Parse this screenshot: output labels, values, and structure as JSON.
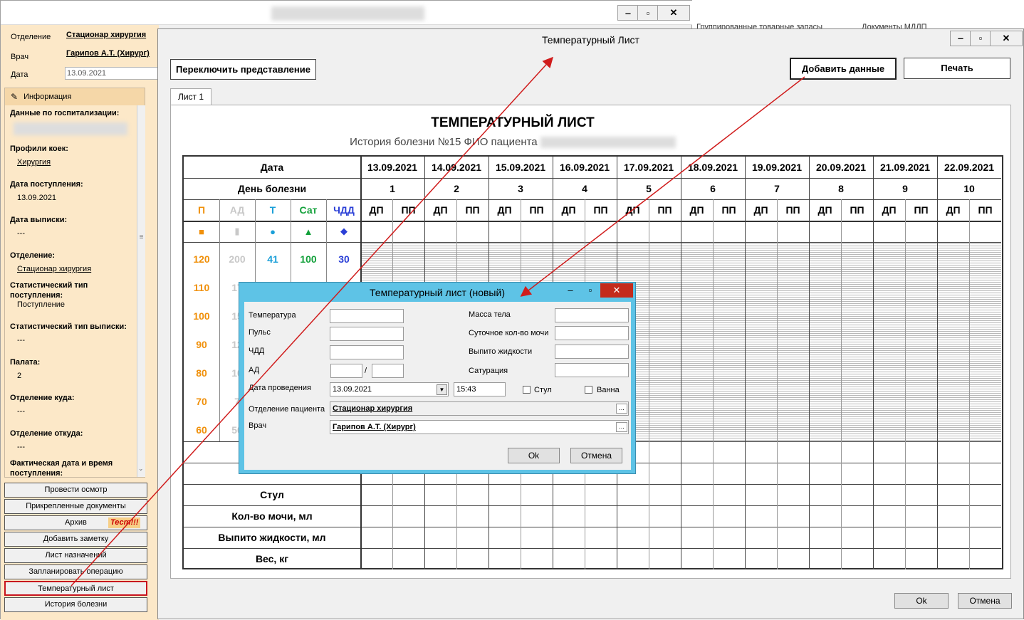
{
  "back": {
    "fields": {
      "dept_label": "Отделение",
      "dept_value": "Стационар хирургия",
      "doctor_label": "Врач",
      "doctor_value": "Гарипов А.Т. (Хирург)",
      "date_label": "Дата",
      "date_value": "13.09.2021"
    },
    "info": {
      "header": "Информация",
      "items": [
        {
          "label": "Данные по госпитализации:",
          "value": ""
        },
        {
          "label": "Профили коек:",
          "value": "Хирургия"
        },
        {
          "label": "Дата поступления:",
          "value": "13.09.2021"
        },
        {
          "label": "Дата выписки:",
          "value": "---"
        },
        {
          "label": "Отделение:",
          "value": "Стационар хирургия"
        },
        {
          "label": "Статистический тип поступления:",
          "value": "Поступление"
        },
        {
          "label": "Статистический тип выписки:",
          "value": "---"
        },
        {
          "label": "Палата:",
          "value": "2"
        },
        {
          "label": "Отделение куда:",
          "value": "---"
        },
        {
          "label": "Отделение откуда:",
          "value": "---"
        },
        {
          "label": "Фактическая дата и время поступления:",
          "value": ""
        }
      ]
    },
    "buttons": [
      "Провести осмотр",
      "Прикрепленные документы",
      "Архив",
      "Добавить заметку",
      "Лист назначений",
      "Запланировать операцию",
      "Температурный лист",
      "История болезни"
    ],
    "archive_badge": "Тест!!!",
    "bg_strip": {
      "item1": "Группированные товарные запасы",
      "item2": "Документы МДЛП"
    }
  },
  "main": {
    "title": "Температурный Лист",
    "switch_btn": "Переключить представление",
    "add_btn": "Добавить данные",
    "print_btn": "Печать",
    "tab": "Лист 1",
    "sheet_title": "ТЕМПЕРАТУРНЫЙ ЛИСТ",
    "sheet_subtitle": "История болезни №15 ФИО пациента",
    "grid": {
      "date_label": "Дата",
      "day_label": "День болезни",
      "dates": [
        "13.09.2021",
        "14.09.2021",
        "15.09.2021",
        "16.09.2021",
        "17.09.2021",
        "18.09.2021",
        "19.09.2021",
        "20.09.2021",
        "21.09.2021",
        "22.09.2021"
      ],
      "days": [
        "1",
        "2",
        "3",
        "4",
        "5",
        "6",
        "7",
        "8",
        "9",
        "10"
      ],
      "half_labels": [
        "ДП",
        "ПП"
      ],
      "params": [
        {
          "label": "П",
          "color": "#f0900a"
        },
        {
          "label": "АД",
          "color": "#c8c8c8"
        },
        {
          "label": "Т",
          "color": "#1a9fd8"
        },
        {
          "label": "Сат",
          "color": "#12a03a"
        },
        {
          "label": "ЧДД",
          "color": "#2a3fd6"
        }
      ],
      "scale": {
        "p": [
          "120",
          "110",
          "100",
          "90",
          "80",
          "70",
          "60"
        ],
        "ad": [
          "200",
          "17",
          "15",
          "12",
          "10",
          "7",
          "50"
        ],
        "t": [
          "41"
        ],
        "sat": [
          "100"
        ],
        "rr": [
          "30"
        ]
      },
      "bottom_rows": [
        "Стул",
        "Кол-во мочи, мл",
        "Выпито жидкости, мл",
        "Вес, кг"
      ]
    },
    "ok": "Ok",
    "cancel": "Отмена"
  },
  "dialog": {
    "title": "Температурный лист (новый)",
    "temperature": "Температура",
    "pulse": "Пульс",
    "rr": "ЧДД",
    "bp": "АД",
    "bp_sep": "/",
    "weight": "Масса тела",
    "urine": "Суточное кол-во мочи",
    "drunk": "Выпито жидкости",
    "saturation": "Сатурация",
    "date_label": "Дата проведения",
    "date_value": "13.09.2021",
    "time_value": "15:43",
    "stool": "Стул",
    "bath": "Ванна",
    "dept_label": "Отделение пациента",
    "dept_value": "Стационар хирургия",
    "doctor_label": "Врач",
    "doctor_value": "Гарипов А.Т. (Хирург)",
    "ellipsis": "...",
    "ok": "Ok",
    "cancel": "Отмена"
  }
}
